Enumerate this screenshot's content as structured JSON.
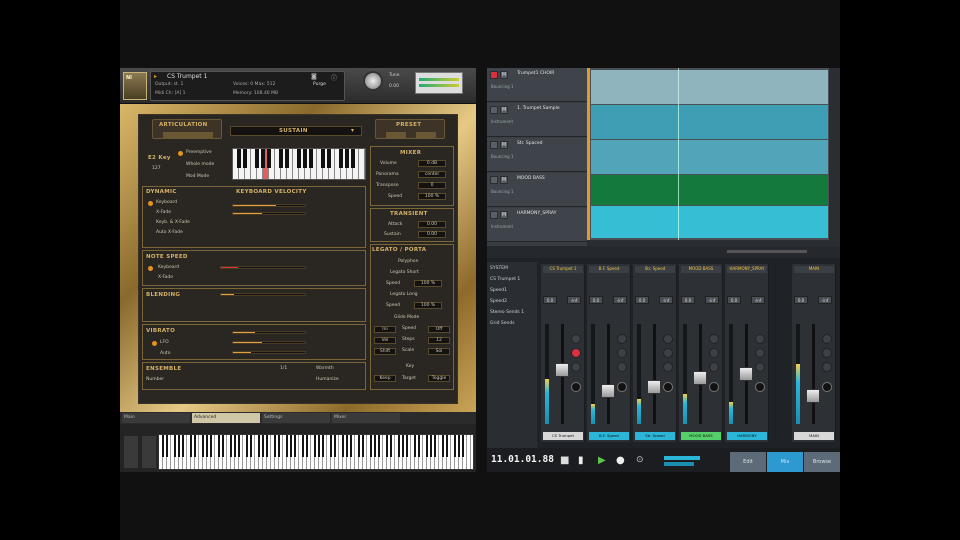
{
  "plugin": {
    "logo_text": "NI",
    "instrument_name": "CS Trumpet 1",
    "output_label": "Output: st. 1",
    "midi_label": "Midi Ch: [A] 1",
    "voices_label": "Voices: 0 Max: 512",
    "memory_label": "Memory: 108.40 MB",
    "purge_label": "Purge",
    "tune_label": "Tune",
    "tune_value": "0.00",
    "articulation_header": "ARTICULATION",
    "sustain_label": "SUSTAIN",
    "preset_header": "PRESET",
    "key_label": "E2 Key",
    "key_value": "127",
    "keyboard_options": [
      "Preemptive",
      "Whole mode",
      "Mod Mode"
    ],
    "dynamic_header": "DYNAMIC",
    "keyboard_velocity_label": "KEYBOARD VELOCITY",
    "dynamic_options": [
      "Keyboard",
      "X-Fade",
      "Keyb. & X-Fade",
      "Auto X-Fade"
    ],
    "note_speed_header": "NOTE SPEED",
    "note_speed_options": [
      "Keyboard",
      "X-Fade"
    ],
    "blending_header": "BLENDING",
    "vibrato_header": "VIBRATO",
    "vibrato_options": [
      "LFO",
      "Auto"
    ],
    "ensemble_header": "ENSEMBLE",
    "ensemble_label": "Number",
    "ensemble_value": "1/1",
    "ensemble_side": [
      "Warmth",
      "Humanize"
    ],
    "right_panel": {
      "mixer_header": "MIXER",
      "volume_label": "Volume",
      "volume_value": "0 dB",
      "panorama_label": "Panorama",
      "panorama_value": "center",
      "transpose_label": "Transpose",
      "transpose_value": "0",
      "speed_label": "Speed",
      "speed_value": "100 %",
      "transient_header": "TRANSIENT",
      "attack_label": "Attack",
      "attack_value": "0.00",
      "sustain2_label": "Sustain",
      "sustain2_value": "0.00",
      "legato_header": "LEGATO / PORTA",
      "polyphon_label": "Polyphon",
      "legato_short_label": "Legato Short",
      "speed2_label": "Speed",
      "speed2_value": "100 %",
      "legato_long_label": "Legato Long",
      "speed3_label": "Speed",
      "speed3_value": "100 %",
      "glide_label": "Glide Mode",
      "grid": [
        "Ini",
        "Speed",
        "Off",
        "Vel",
        "Steps",
        "12",
        "Shift",
        "Scale",
        "Sol"
      ],
      "key_label": "Key",
      "keep_label": "Keep",
      "target_label": "Target",
      "toggle_label": "Toggle"
    },
    "bottom_tabs": [
      "Main",
      "Advanced",
      "Settings",
      "Mixer"
    ]
  },
  "daw": {
    "tracks": [
      {
        "name": "Trumpet1 CHOIR",
        "sub": "Bouncing 1"
      },
      {
        "name": "1. Trumpet Sample",
        "sub": "Instrument"
      },
      {
        "name": "Str. Spaced",
        "sub": "Bouncing 1"
      },
      {
        "name": "MOOD BASS",
        "sub": "Bouncing 1"
      },
      {
        "name": "HARMONY_SPRAY",
        "sub": "Instrument"
      }
    ],
    "track_buttons": [
      "M",
      "S"
    ],
    "mixer_nav": [
      "SYSTEM",
      "CS Trumpet 1",
      "Speed1",
      "Speed2",
      "Stereo Sends 1",
      "Grid Sends"
    ],
    "channels": [
      {
        "name": "CS Trumpet 1",
        "label": "CS Trumpet",
        "label_color": "#d8d8d8",
        "fader": 0.55,
        "meter": 0.45
      },
      {
        "name": "B.F. Speed",
        "label": "B.F. Speed",
        "label_color": "#2bb6d8",
        "fader": 0.3,
        "meter": 0.2
      },
      {
        "name": "Str. Speed",
        "label": "Str. Speed",
        "label_color": "#2bb6d8",
        "fader": 0.35,
        "meter": 0.25
      },
      {
        "name": "MOOD BASS",
        "label": "MOOD BASS",
        "label_color": "#56d06a",
        "fader": 0.45,
        "meter": 0.3
      },
      {
        "name": "HARMONY_SPRAY",
        "label": "HARMONY",
        "label_color": "#2bb6d8",
        "fader": 0.5,
        "meter": 0.22
      }
    ],
    "master": {
      "name": "MAIN",
      "label": "MAIN",
      "fader": 0.25,
      "meter": 0.6
    },
    "channel_values": [
      "0.0",
      "-inf"
    ],
    "time": "11.01.01.88",
    "transport_buttons": [
      "stop",
      "play",
      "record"
    ],
    "tabs": [
      "Edit",
      "Mix",
      "Browse"
    ],
    "active_tab": "Mix"
  }
}
